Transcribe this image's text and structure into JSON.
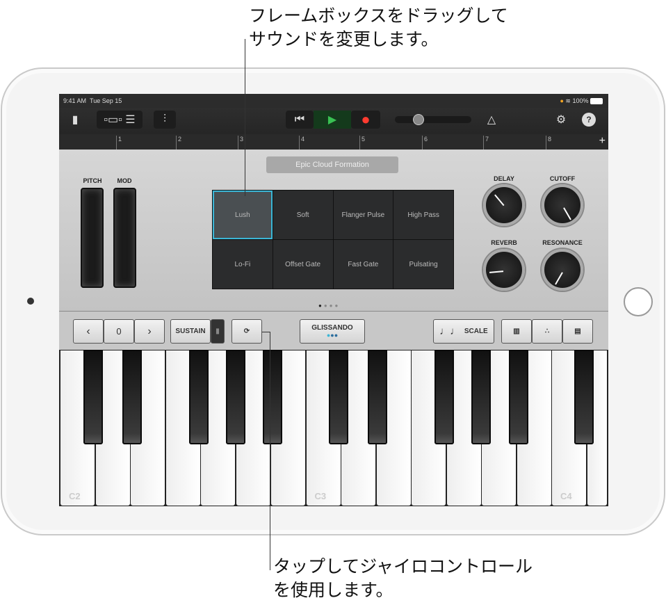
{
  "callouts": {
    "top": [
      "フレームボックスをドラッグして",
      "サウンドを変更します。"
    ],
    "bottom": [
      "タップしてジャイロコントロール",
      "を使用します。"
    ]
  },
  "status": {
    "time": "9:41 AM",
    "date": "Tue Sep 15",
    "battery": "100%"
  },
  "toolbar": {
    "play_color": "#39c153",
    "record_color": "#ff3b30"
  },
  "ruler": [
    "1",
    "2",
    "3",
    "4",
    "5",
    "6",
    "7",
    "8"
  ],
  "patch_name": "Epic Cloud Formation",
  "wheels": {
    "pitch": "PITCH",
    "mod": "MOD"
  },
  "sounds": [
    "Lush",
    "Soft",
    "Flanger Pulse",
    "High Pass",
    "Lo-Fi",
    "Offset Gate",
    "Fast Gate",
    "Pulsating"
  ],
  "knobs": {
    "delay": "DELAY",
    "cutoff": "CUTOFF",
    "reverb": "REVERB",
    "resonance": "RESONANCE"
  },
  "controls": {
    "octave": "0",
    "sustain": "SUSTAIN",
    "glissando": "GLISSANDO",
    "scale": "SCALE"
  },
  "keys": {
    "c2": "C2",
    "c3": "C3",
    "c4": "C4"
  },
  "accent": "#3bb6d6"
}
